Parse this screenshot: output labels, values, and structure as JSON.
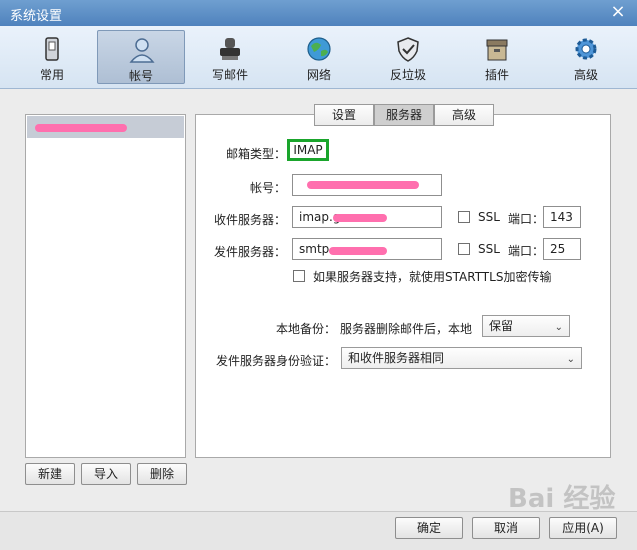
{
  "window": {
    "title": "系统设置",
    "close_icon": "×"
  },
  "toolbar": [
    {
      "label": "常用",
      "icon": "phone-icon",
      "active": false
    },
    {
      "label": "帐号",
      "icon": "user-icon",
      "active": true
    },
    {
      "label": "写邮件",
      "icon": "stamp-icon",
      "active": false
    },
    {
      "label": "网络",
      "icon": "globe-icon",
      "active": false
    },
    {
      "label": "反垃圾",
      "icon": "shield-icon",
      "active": false
    },
    {
      "label": "插件",
      "icon": "box-icon",
      "active": false
    },
    {
      "label": "高级",
      "icon": "gear-icon",
      "active": false
    }
  ],
  "account_list": {
    "buttons": {
      "new": "新建",
      "import": "导入",
      "delete": "删除"
    }
  },
  "tabs": [
    {
      "label": "设置",
      "selected": false
    },
    {
      "label": "服务器",
      "selected": true
    },
    {
      "label": "高级",
      "selected": false
    }
  ],
  "form": {
    "mailbox_type_label": "邮箱类型：",
    "mailbox_type_value": "IMAP",
    "account_label": "帐号：",
    "incoming_label": "收件服务器：",
    "incoming_value": "imap.g",
    "outgoing_label": "发件服务器：",
    "outgoing_value": "smtp",
    "ssl_label": "SSL",
    "port_label": "端口：",
    "incoming_port": "143",
    "outgoing_port": "25",
    "starttls_label": "如果服务器支持，就使用STARTTLS加密传输",
    "backup_label": "本地备份：",
    "backup_desc": "服务器删除邮件后，本地",
    "backup_value": "保留",
    "auth_label": "发件服务器身份验证：",
    "auth_value": "和收件服务器相同"
  },
  "footer": {
    "ok": "确定",
    "cancel": "取消",
    "apply": "应用(A)"
  },
  "watermark": "Bai 经验",
  "colors": {
    "accent": "#1aa52c",
    "mask": "#ff6fae"
  }
}
